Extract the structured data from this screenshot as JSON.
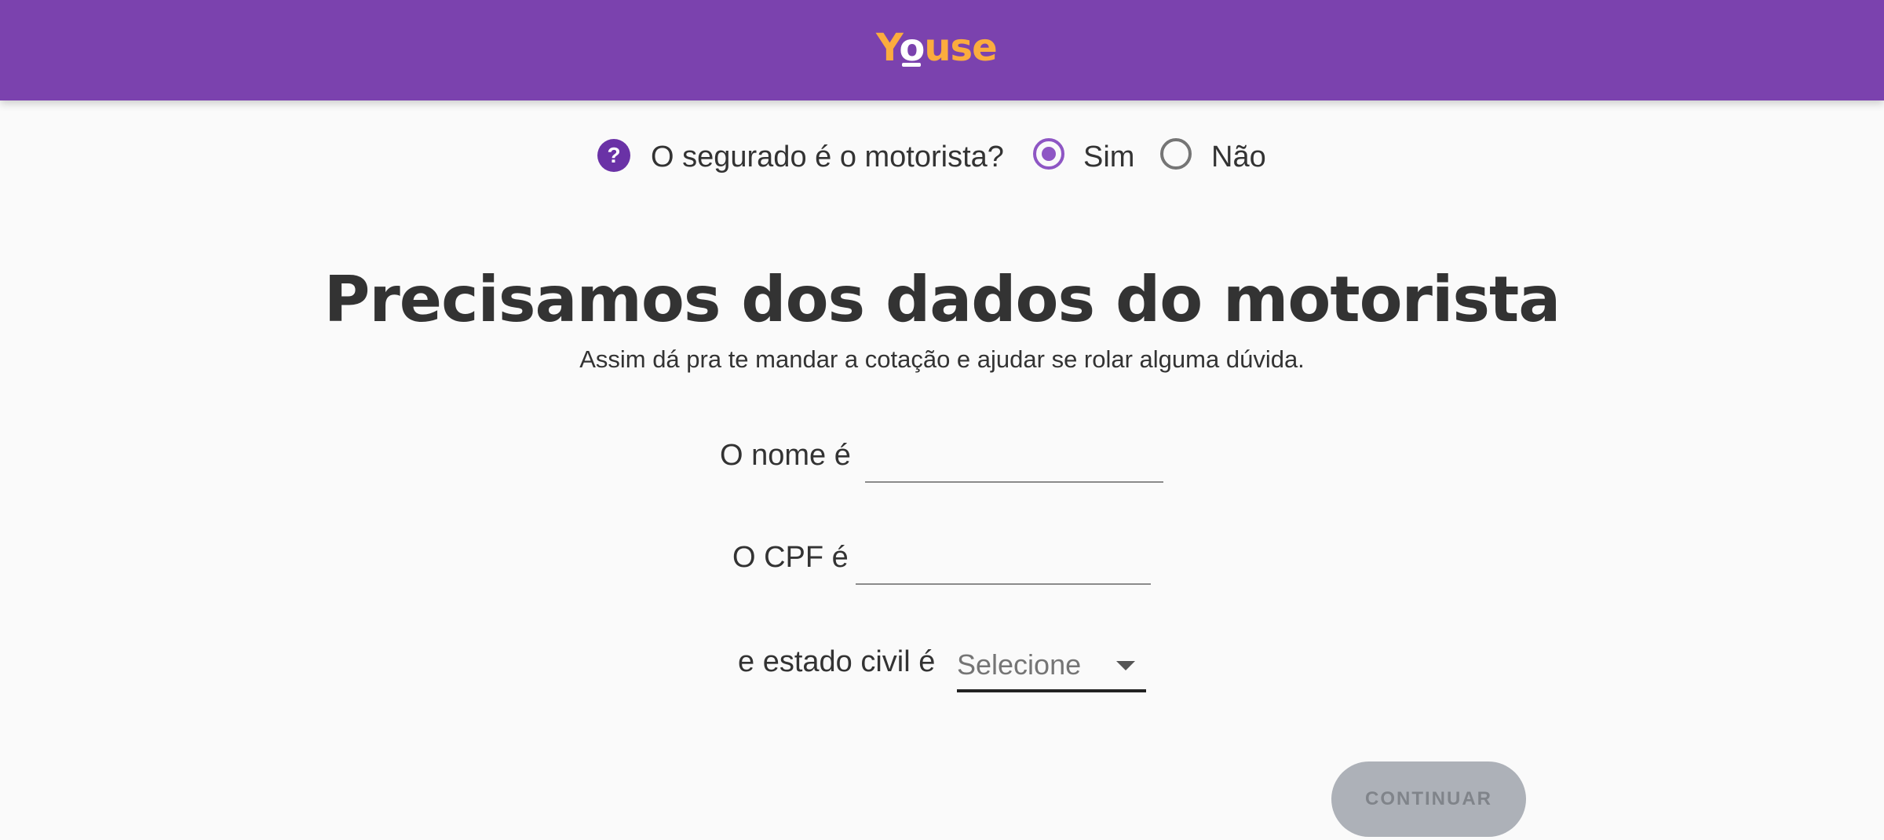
{
  "header": {
    "logo_prefix": "Y",
    "logo_o": "o",
    "logo_suffix": "use",
    "background_color": "#7b42ae",
    "logo_color": "#fbac3e"
  },
  "question": {
    "help_icon": "help-circle-icon",
    "help_glyph": "?",
    "text": "O segurado é o motorista?",
    "options": [
      {
        "label": "Sim",
        "checked": true
      },
      {
        "label": "Não",
        "checked": false
      }
    ]
  },
  "main": {
    "title": "Precisamos dos dados do motorista",
    "subtitle": "Assim dá pra te mandar a cotação e ajudar se rolar alguma dúvida."
  },
  "form": {
    "name_label": "O nome é",
    "name_value": "",
    "cpf_label": "O CPF é",
    "cpf_value": "",
    "civil_label": "e estado civil é",
    "civil_selected": "Selecione",
    "civil_icon": "chevron-down-icon"
  },
  "actions": {
    "continue_label": "CONTINUAR",
    "continue_disabled": true
  },
  "colors": {
    "accent": "#8e56c4",
    "text": "#333333",
    "button_disabled_bg": "#adb1b8"
  }
}
